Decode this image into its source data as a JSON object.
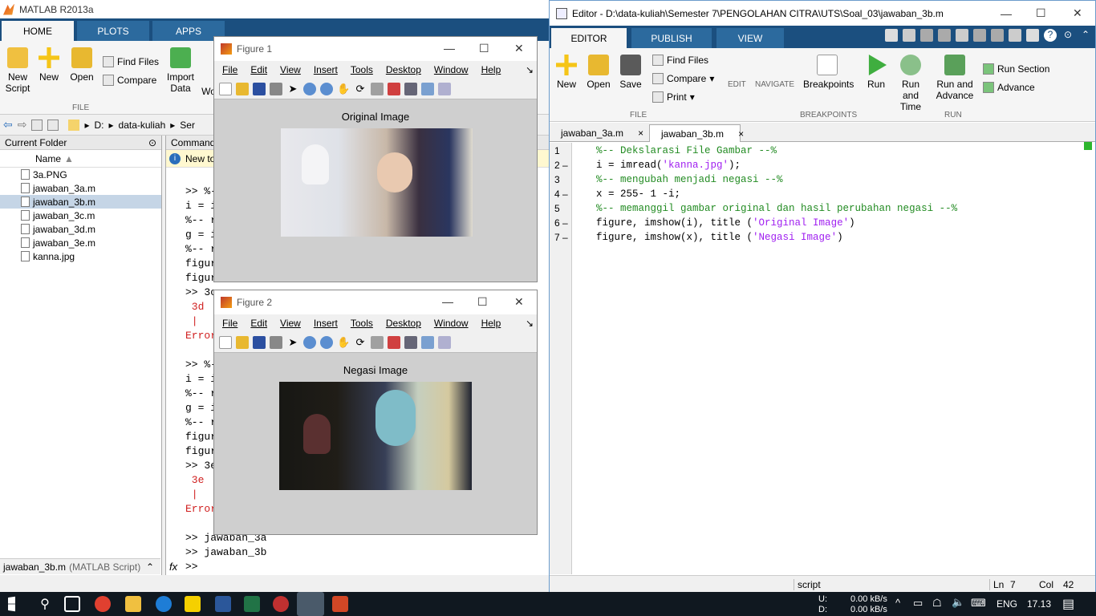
{
  "matlab": {
    "title": "MATLAB R2013a",
    "tabs": [
      "HOME",
      "PLOTS",
      "APPS"
    ],
    "ribbon": {
      "new_script": "New Script",
      "new": "New",
      "open": "Open",
      "find_files": "Find Files",
      "compare": "Compare",
      "import_data": "Import Data",
      "wo": "Wo",
      "file_group": "FILE"
    },
    "path": [
      "D:",
      "data-kuliah",
      "Ser"
    ],
    "current_folder": {
      "title": "Current Folder",
      "column": "Name",
      "files": [
        "3a.PNG",
        "jawaban_3a.m",
        "jawaban_3b.m",
        "jawaban_3c.m",
        "jawaban_3d.m",
        "jawaban_3e.m",
        "kanna.jpg"
      ],
      "selected": "jawaban_3b.m",
      "footer_name": "jawaban_3b.m",
      "footer_type": "(MATLAB Script)"
    },
    "command": {
      "title": "Command",
      "new_to": "New to",
      "lines": [
        ">> %-",
        "i = i",
        "%-- r",
        "g = i",
        "%-- r",
        "figur",
        "figur",
        ">> 3c",
        " 3d",
        " |",
        "Error",
        ">> %-",
        "i = i",
        "%-- r",
        "g = i",
        "%-- r",
        "figur",
        "figur",
        ">> 3e",
        " 3e",
        " |",
        "Error",
        ">> jawaban_3a",
        ">> jawaban_3b",
        ">>"
      ],
      "fx": "fx"
    }
  },
  "figure1": {
    "title": "Figure 1",
    "menu": [
      "File",
      "Edit",
      "View",
      "Insert",
      "Tools",
      "Desktop",
      "Window",
      "Help"
    ],
    "plot_title": "Original Image"
  },
  "figure2": {
    "title": "Figure 2",
    "menu": [
      "File",
      "Edit",
      "View",
      "Insert",
      "Tools",
      "Desktop",
      "Window",
      "Help"
    ],
    "plot_title": "Negasi Image"
  },
  "editor": {
    "title": "Editor - D:\\data-kuliah\\Semester 7\\PENGOLAHAN CITRA\\UTS\\Soal_03\\jawaban_3b.m",
    "tabs": [
      "EDITOR",
      "PUBLISH",
      "VIEW"
    ],
    "ribbon": {
      "new": "New",
      "open": "Open",
      "save": "Save",
      "find_files": "Find Files",
      "compare": "Compare",
      "print": "Print",
      "edit": "EDIT",
      "navigate": "NAVIGATE",
      "breakpoints": "Breakpoints",
      "run": "Run",
      "run_and_time": "Run and Time",
      "run_and_advance": "Run and Advance",
      "run_section": "Run Section",
      "advance": "Advance",
      "file_group": "FILE",
      "breakpoints_group": "BREAKPOINTS",
      "run_group": "RUN"
    },
    "file_tabs": [
      "jawaban_3a.m",
      "jawaban_3b.m"
    ],
    "code": [
      {
        "n": "1",
        "dash": "",
        "text": "%-- Dekslarasi File Gambar --%",
        "type": "comment"
      },
      {
        "n": "2",
        "dash": "–",
        "pre": "i = imread(",
        "str": "'kanna.jpg'",
        "post": ");",
        "type": "mixed"
      },
      {
        "n": "3",
        "dash": "",
        "text": "%-- mengubah menjadi negasi --%",
        "type": "comment"
      },
      {
        "n": "4",
        "dash": "–",
        "text": "x = 255- 1 -i;",
        "type": "code"
      },
      {
        "n": "5",
        "dash": "",
        "text": "%-- memanggil gambar original dan hasil perubahan negasi --%",
        "type": "comment"
      },
      {
        "n": "6",
        "dash": "–",
        "pre": "figure, imshow(i), title (",
        "str": "'Original Image'",
        "post": ")",
        "type": "mixed"
      },
      {
        "n": "7",
        "dash": "–",
        "pre": "figure, imshow(x), title (",
        "str": "'Negasi Image'",
        "post": ")",
        "type": "mixed"
      }
    ],
    "status": {
      "mode": "script",
      "ln_label": "Ln",
      "ln": "7",
      "col_label": "Col",
      "col": "42"
    }
  },
  "taskbar": {
    "net_u": "U:",
    "net_d": "D:",
    "net_u_val": "0.00 kB/s",
    "net_d_val": "0.00 kB/s",
    "lang": "ENG",
    "time": "17.13"
  },
  "colors": {
    "comment": "#228b22",
    "string": "#a020f0",
    "ribbon_tab": "#1b4f7f"
  }
}
